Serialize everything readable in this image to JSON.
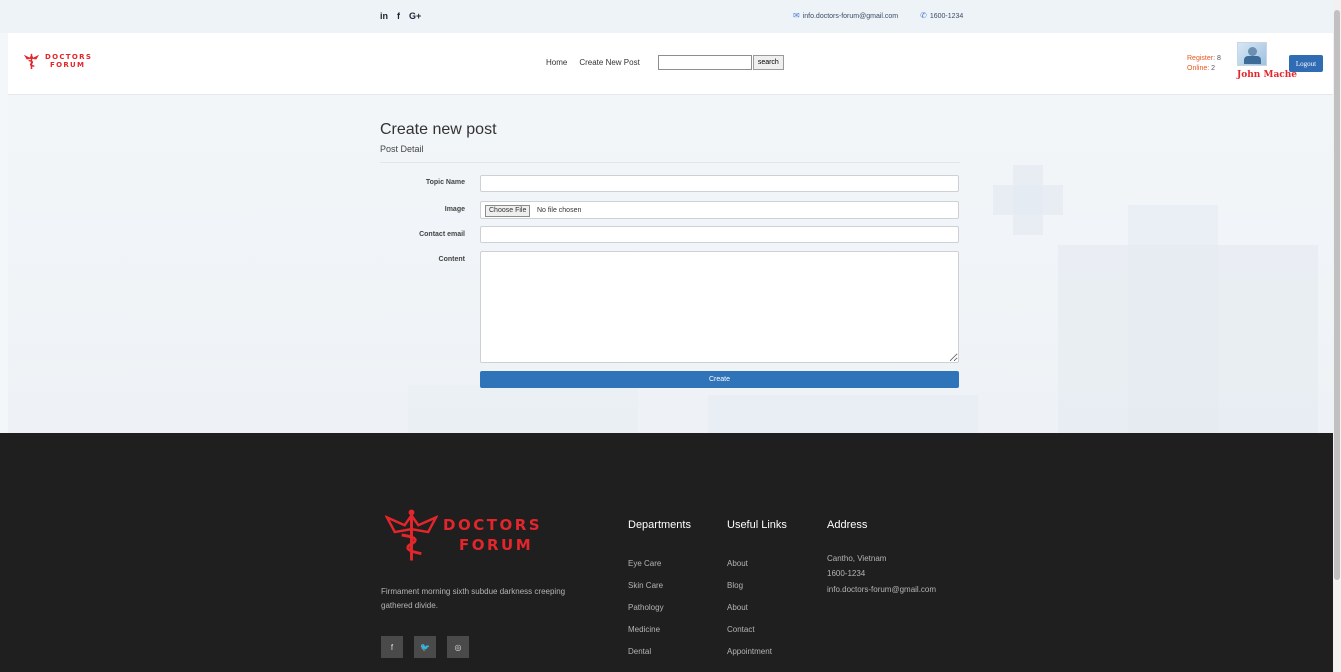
{
  "topbar": {
    "social": [
      {
        "icon": "linkedin-icon",
        "text": "in"
      },
      {
        "icon": "facebook-icon",
        "text": "f"
      },
      {
        "icon": "google-plus-icon",
        "text": "G+"
      }
    ],
    "email": "info.doctors-forum@gmail.com",
    "phone": "1600-1234"
  },
  "brand": {
    "line1": "DOCTORS",
    "line2": "FORUM",
    "color": "#e3262b"
  },
  "nav": {
    "home": "Home",
    "create": "Create New Post",
    "search_value": "",
    "search_button": "search"
  },
  "user": {
    "register_label": "Register:",
    "register_count": "8",
    "online_label": "Online:",
    "online_count": "2",
    "name": "John Mache",
    "logout": "Logout"
  },
  "form": {
    "title": "Create new post",
    "subtitle": "Post Detail",
    "labels": {
      "topic": "Topic Name",
      "image": "Image",
      "email": "Contact email",
      "content": "Content"
    },
    "values": {
      "topic": "",
      "email": "",
      "content": ""
    },
    "file_button": "Choose File",
    "file_status": "No file chosen",
    "submit": "Create"
  },
  "footer": {
    "tagline": "Firmament morning sixth subdue darkness creeping gathered divide.",
    "social": [
      {
        "icon": "facebook-icon",
        "text": "f"
      },
      {
        "icon": "twitter-icon",
        "text": "🐦"
      },
      {
        "icon": "instagram-icon",
        "text": "◎"
      }
    ],
    "departments": {
      "title": "Departments",
      "items": [
        "Eye Care",
        "Skin Care",
        "Pathology",
        "Medicine",
        "Dental"
      ]
    },
    "links": {
      "title": "Useful Links",
      "items": [
        "About",
        "Blog",
        "About",
        "Contact",
        "Appointment"
      ]
    },
    "address": {
      "title": "Address",
      "items": [
        "Cantho, Vietnam",
        "1600-1234",
        "info.doctors-forum@gmail.com"
      ]
    }
  },
  "colors": {
    "accent": "#2f73b9",
    "brand_red": "#e3262b",
    "footer_bg": "#1f1f1f"
  }
}
